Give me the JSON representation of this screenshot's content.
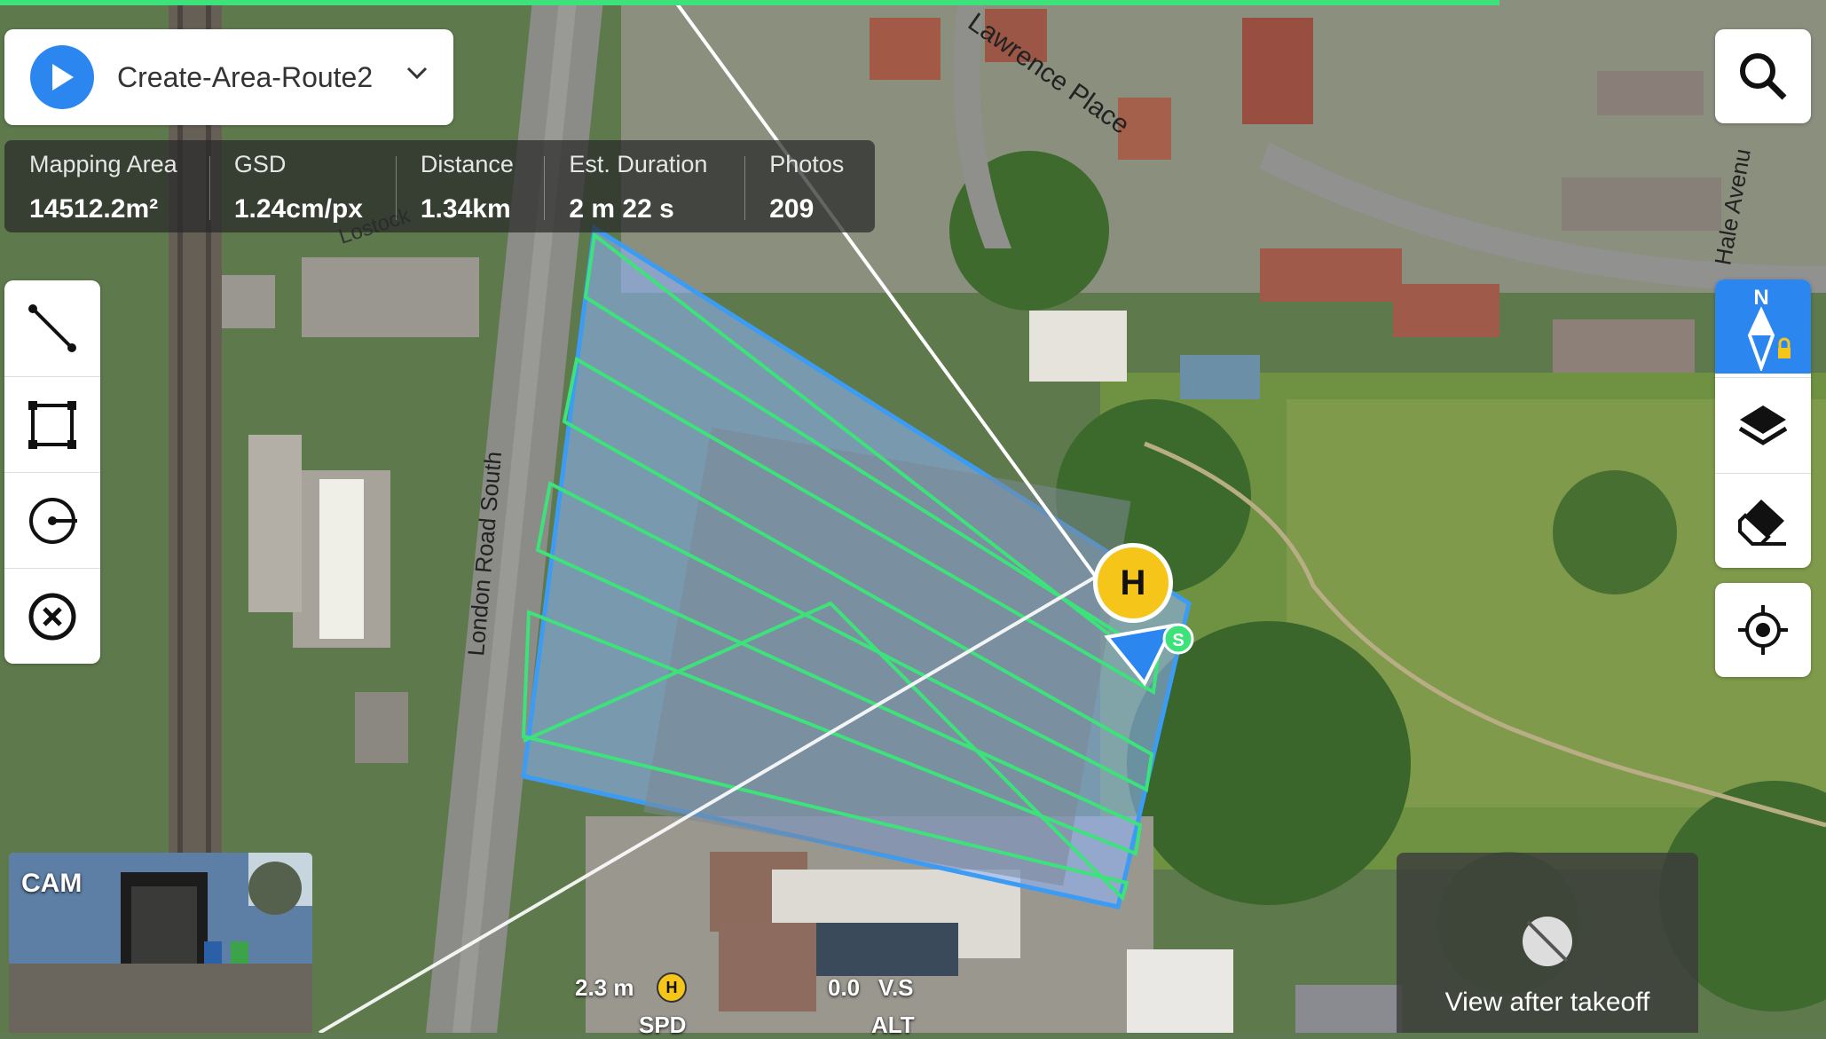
{
  "route": {
    "name": "Create-Area-Route2"
  },
  "stats": [
    {
      "label": "Mapping Area",
      "value": "14512.2m²"
    },
    {
      "label": "GSD",
      "value": "1.24cm/px"
    },
    {
      "label": "Distance",
      "value": "1.34km"
    },
    {
      "label": "Est. Duration",
      "value": "2 m 22 s"
    },
    {
      "label": "Photos",
      "value": "209"
    }
  ],
  "map": {
    "street_labels": [
      "Lawrence Place",
      "London Road South",
      "Hale Avenu",
      "Lostock"
    ],
    "home_marker": "H",
    "start_marker": "S",
    "compass_letter": "N"
  },
  "telemetry": {
    "height": "2.3 m",
    "home_symbol": "H",
    "vertical_speed": "0.0",
    "vs_label": "V.S",
    "spd_label": "SPD",
    "alt_label": "ALT"
  },
  "camera": {
    "label": "CAM"
  },
  "view_panel": {
    "label": "View after takeoff"
  },
  "icons": {
    "left_toolbar": [
      "line-draw-icon",
      "area-rectangle-icon",
      "orbit-icon",
      "close-circle-icon"
    ],
    "right_toolbar": [
      "search-icon",
      "compass-icon",
      "layers-icon",
      "eraser-icon",
      "locate-icon"
    ]
  },
  "colors": {
    "accent": "#2b86f0",
    "flight_path": "#3de27a",
    "area_fill": "#8fb4ff",
    "home_marker": "#f6c51a"
  }
}
